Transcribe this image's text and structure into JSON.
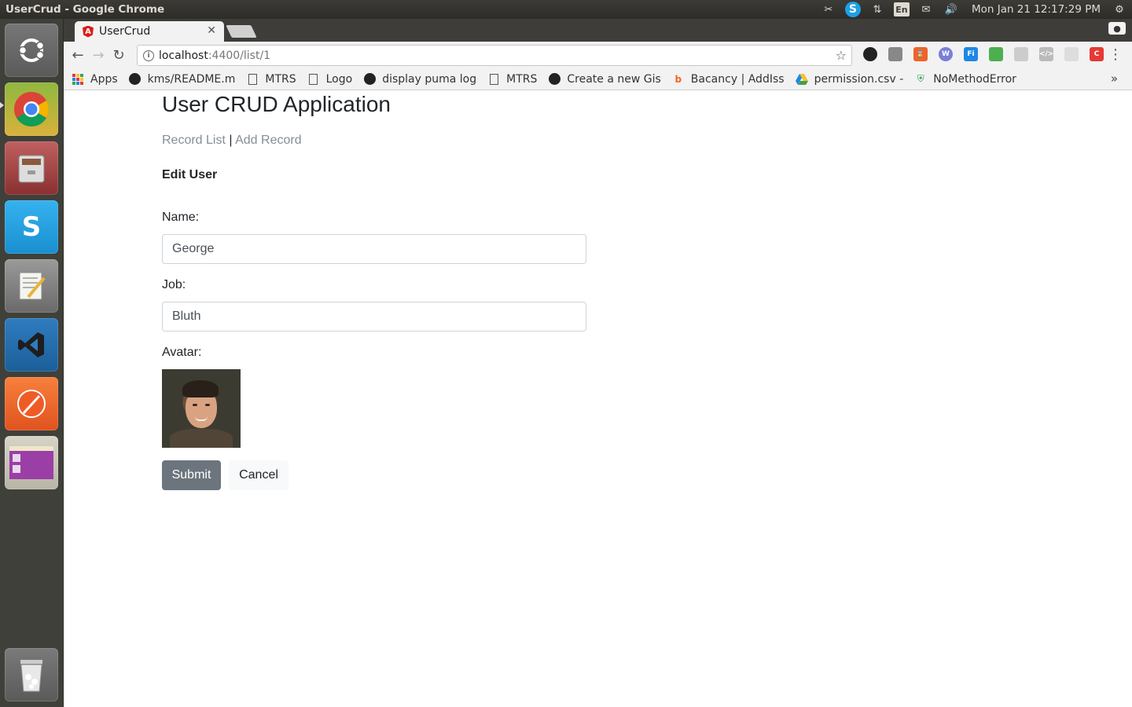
{
  "window": {
    "title": "UserCrud - Google Chrome"
  },
  "tray": {
    "keyboard": "En",
    "clock": "Mon Jan 21 12:17:29 PM"
  },
  "launcher": {
    "items": [
      "ubuntu-dash",
      "chrome",
      "files",
      "skype",
      "text-editor",
      "vscode",
      "postman",
      "workspace-app",
      "trash"
    ]
  },
  "browser": {
    "tab_title": "UserCrud",
    "url_host": "localhost",
    "url_path": ":4400/list/1",
    "bookmarks": [
      {
        "label": "Apps",
        "icon": "apps-grid-icon"
      },
      {
        "label": "kms/README.m",
        "icon": "github-icon"
      },
      {
        "label": "MTRS",
        "icon": "document-icon"
      },
      {
        "label": "Logo",
        "icon": "document-icon"
      },
      {
        "label": "display puma log",
        "icon": "github-icon"
      },
      {
        "label": "MTRS",
        "icon": "document-icon"
      },
      {
        "label": "Create a new Gis",
        "icon": "github-icon"
      },
      {
        "label": "Bacancy | AddIss",
        "icon": "bacancy-icon"
      },
      {
        "label": "permission.csv -",
        "icon": "google-drive-icon"
      },
      {
        "label": "NoMethodError",
        "icon": "shield-icon"
      }
    ],
    "colors": {
      "angular": "#dd1b16"
    }
  },
  "page": {
    "app_title": "User CRUD Application",
    "nav": {
      "record_list": "Record List",
      "separator": "|",
      "add_record": "Add Record"
    },
    "section_title": "Edit User",
    "form": {
      "name_label": "Name:",
      "name_value": "George",
      "job_label": "Job:",
      "job_value": "Bluth",
      "avatar_label": "Avatar:",
      "submit_label": "Submit",
      "cancel_label": "Cancel"
    },
    "colors": {
      "submit_bg": "#6c757d",
      "link": "#868e96"
    }
  }
}
